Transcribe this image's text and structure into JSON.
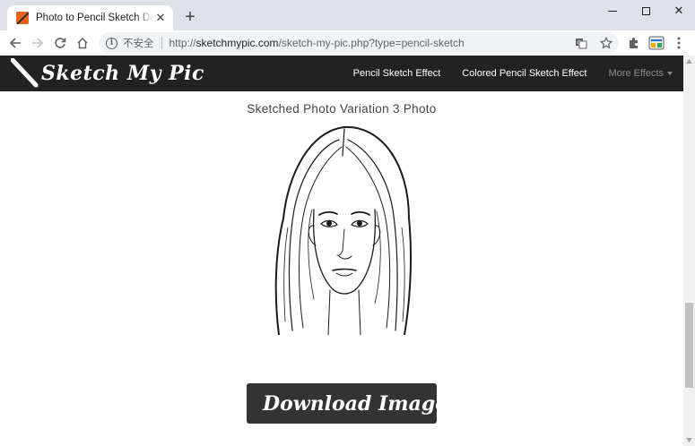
{
  "browser": {
    "tab": {
      "title": "Photo to Pencil Sketch Download"
    },
    "new_tab_symbol": "+",
    "address": {
      "security_label": "不安全",
      "url_scheme": "http://",
      "url_host": "sketchmypic.com",
      "url_path": "/sketch-my-pic.php?type=pencil-sketch"
    },
    "icons": [
      "back-icon",
      "forward-icon",
      "reload-icon",
      "home-icon",
      "info-icon",
      "translate-icon",
      "star-icon",
      "extensions-icon",
      "profile-icon",
      "menu-icon"
    ]
  },
  "site": {
    "brand": "Sketch My Pic",
    "nav": {
      "items": [
        "Pencil Sketch Effect",
        "Colored Pencil Sketch Effect"
      ],
      "more": "More Effects"
    }
  },
  "main": {
    "title": "Sketched Photo Variation 3 Photo",
    "download_label": "Download Image"
  },
  "colors": {
    "navbar": "#222222",
    "download_button": "#333333",
    "download_icon": "#e8641c",
    "favicon": "#e8641c"
  }
}
